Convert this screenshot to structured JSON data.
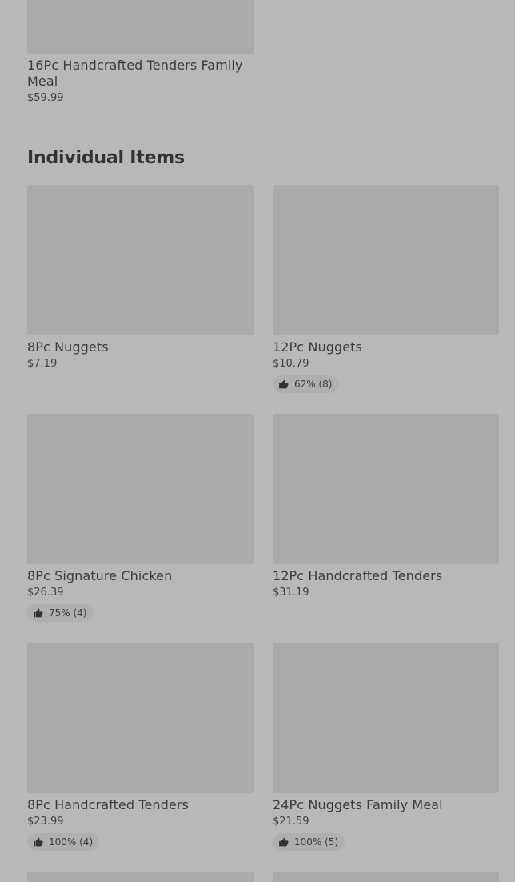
{
  "top_item": {
    "name": "16Pc Handcrafted Tenders Family Meal",
    "price": "$59.99"
  },
  "section": {
    "title": "Individual Items"
  },
  "items": [
    {
      "name": "8Pc Nuggets",
      "price": "$7.19",
      "rating": ""
    },
    {
      "name": "12Pc Nuggets",
      "price": "$10.79",
      "rating": "62% (8)"
    },
    {
      "name": "8Pc Signature Chicken",
      "price": "$26.39",
      "rating": "75% (4)"
    },
    {
      "name": "12Pc Handcrafted Tenders",
      "price": "$31.19",
      "rating": ""
    },
    {
      "name": "8Pc Handcrafted Tenders",
      "price": "$23.99",
      "rating": "100% (4)"
    },
    {
      "name": "24Pc Nuggets Family Meal",
      "price": "$21.59",
      "rating": "100% (5)"
    }
  ],
  "icons": {
    "rating": "thumbs-up-icon"
  },
  "colors": {
    "background": "#b8b8b8",
    "image_placeholder": "#aaaaaa",
    "rating_pill": "#afafaf",
    "text": "#3a3a3a"
  }
}
